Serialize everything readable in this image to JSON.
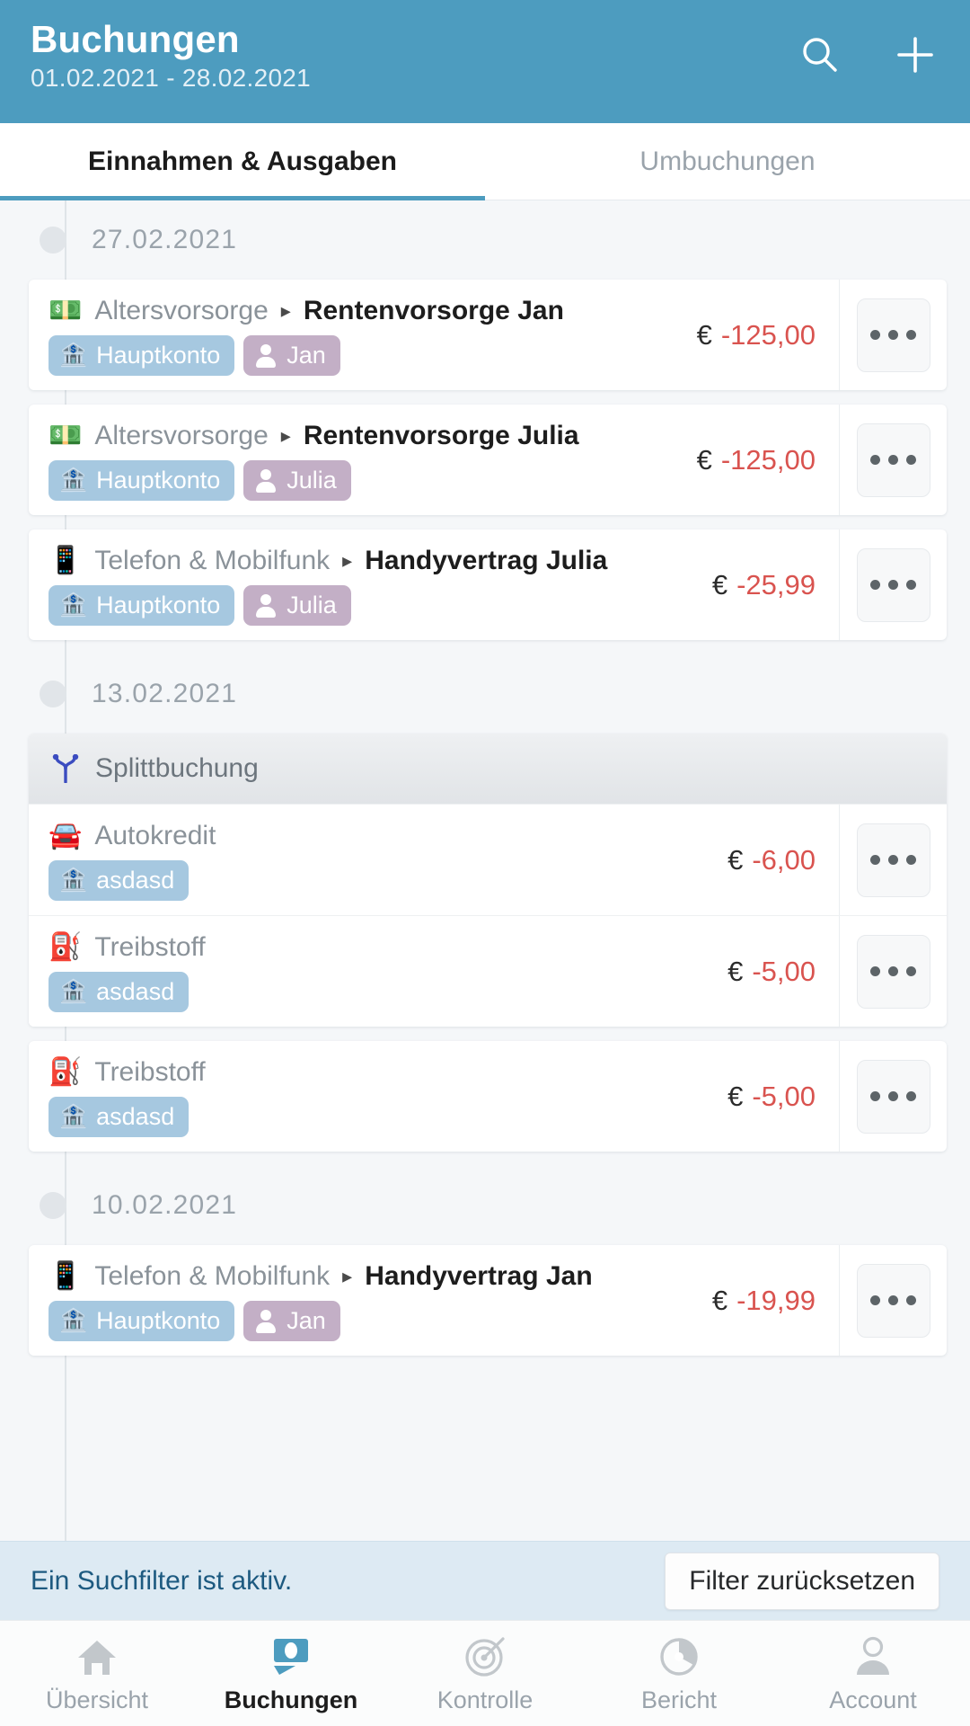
{
  "header": {
    "title": "Buchungen",
    "date_range": "01.02.2021 - 28.02.2021",
    "search_icon": "search-icon",
    "add_icon": "plus-icon"
  },
  "tabs": [
    {
      "label": "Einnahmen & Ausgaben",
      "active": true
    },
    {
      "label": "Umbuchungen",
      "active": false
    }
  ],
  "groups": [
    {
      "date": "27.02.2021",
      "entries": [
        {
          "type": "transaction",
          "icon": "money-icon",
          "icon_glyph": "💵",
          "category": "Altersvorsorge",
          "separator": "▸",
          "subcategory": "Rentenvorsorge Jan",
          "chips": [
            {
              "kind": "account",
              "icon": "bank-icon",
              "label": "Hauptkonto"
            },
            {
              "kind": "person",
              "icon": "person-icon",
              "label": "Jan"
            }
          ],
          "currency": "€",
          "amount": "-125,00",
          "menu": "more-options"
        },
        {
          "type": "transaction",
          "icon": "money-icon",
          "icon_glyph": "💵",
          "category": "Altersvorsorge",
          "separator": "▸",
          "subcategory": "Rentenvorsorge Julia",
          "chips": [
            {
              "kind": "account",
              "icon": "bank-icon",
              "label": "Hauptkonto"
            },
            {
              "kind": "person",
              "icon": "person-icon",
              "label": "Julia"
            }
          ],
          "currency": "€",
          "amount": "-125,00",
          "menu": "more-options"
        },
        {
          "type": "transaction",
          "icon": "mobile-phone-icon",
          "icon_glyph": "📱",
          "category": "Telefon & Mobilfunk",
          "separator": "▸",
          "subcategory": "Handyvertrag Julia",
          "chips": [
            {
              "kind": "account",
              "icon": "bank-icon",
              "label": "Hauptkonto"
            },
            {
              "kind": "person",
              "icon": "person-icon",
              "label": "Julia"
            }
          ],
          "currency": "€",
          "amount": "-25,99",
          "menu": "more-options"
        }
      ]
    },
    {
      "date": "13.02.2021",
      "entries": [
        {
          "type": "split",
          "split_label": "Splittbuchung",
          "split_icon": "split-fork-icon",
          "items": [
            {
              "icon": "car-icon",
              "icon_glyph": "🚘",
              "category": "Autokredit",
              "chips": [
                {
                  "kind": "account",
                  "icon": "bank-icon",
                  "label": "asdasd"
                }
              ],
              "currency": "€",
              "amount": "-6,00",
              "menu": "more-options"
            },
            {
              "icon": "fuel-pump-icon",
              "icon_glyph": "⛽",
              "category": "Treibstoff",
              "chips": [
                {
                  "kind": "account",
                  "icon": "bank-icon",
                  "label": "asdasd"
                }
              ],
              "currency": "€",
              "amount": "-5,00",
              "menu": "more-options"
            }
          ]
        },
        {
          "type": "transaction",
          "icon": "fuel-pump-icon",
          "icon_glyph": "⛽",
          "category": "Treibstoff",
          "chips": [
            {
              "kind": "account",
              "icon": "bank-icon",
              "label": "asdasd"
            }
          ],
          "currency": "€",
          "amount": "-5,00",
          "menu": "more-options"
        }
      ]
    },
    {
      "date": "10.02.2021",
      "entries": [
        {
          "type": "transaction",
          "icon": "mobile-phone-icon",
          "icon_glyph": "📱",
          "category": "Telefon & Mobilfunk",
          "separator": "▸",
          "subcategory": "Handyvertrag Jan",
          "chips": [
            {
              "kind": "account",
              "icon": "bank-icon",
              "label": "Hauptkonto"
            },
            {
              "kind": "person",
              "icon": "person-icon",
              "label": "Jan"
            }
          ],
          "currency": "€",
          "amount": "-19,99",
          "menu": "more-options"
        }
      ]
    }
  ],
  "filter_bar": {
    "message": "Ein Suchfilter ist aktiv.",
    "reset_label": "Filter zurücksetzen"
  },
  "bottom_nav": [
    {
      "label": "Übersicht",
      "icon": "home-icon",
      "active": false
    },
    {
      "label": "Buchungen",
      "icon": "banknote-icon",
      "active": true
    },
    {
      "label": "Kontrolle",
      "icon": "target-icon",
      "active": false
    },
    {
      "label": "Bericht",
      "icon": "pie-chart-icon",
      "active": false
    },
    {
      "label": "Account",
      "icon": "person-icon",
      "active": false
    }
  ],
  "colors": {
    "header_bg": "#4d9cbf",
    "accent": "#4d9cbf",
    "negative_amount": "#d9534f",
    "chip_account": "#a6c8e0",
    "chip_person": "#c3afc6",
    "filter_bar_bg": "#ddeaf3",
    "filter_text": "#1d5a80",
    "split_icon": "#3b4cc0"
  }
}
